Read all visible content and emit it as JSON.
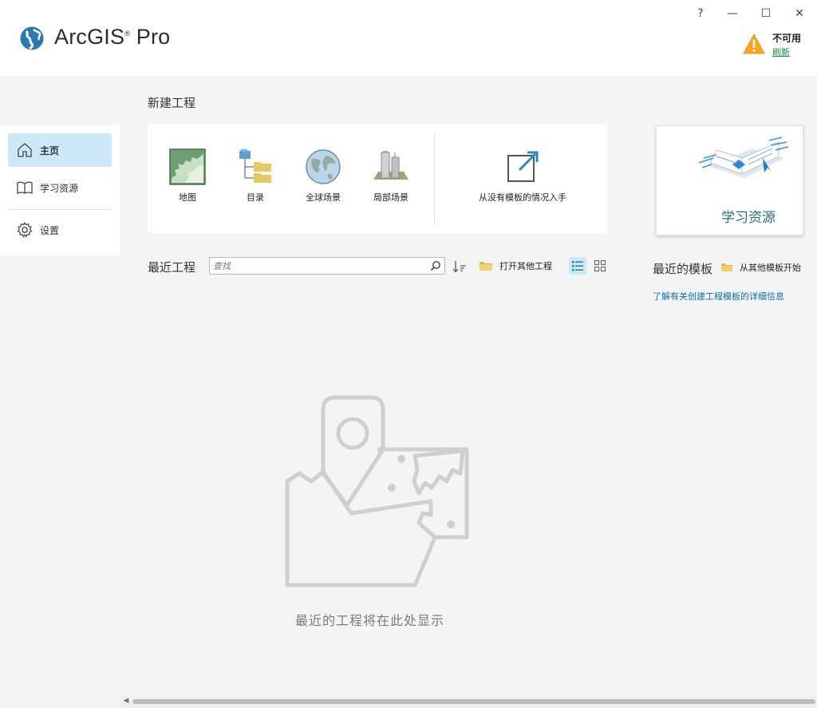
{
  "app": {
    "name": "ArcGIS",
    "name_suffix": "Pro"
  },
  "window": {
    "help": "?",
    "minimize": "—",
    "maximize": "☐",
    "close": "✕"
  },
  "license": {
    "status": "不可用",
    "refresh": "刷新"
  },
  "sidebar": {
    "items": [
      {
        "label": "主页",
        "icon": "home-icon",
        "selected": true
      },
      {
        "label": "学习资源",
        "icon": "book-icon"
      },
      {
        "label": "设置",
        "icon": "gear-icon"
      }
    ]
  },
  "new_project": {
    "title": "新建工程",
    "tiles": [
      {
        "label": "地图",
        "icon": "map-icon"
      },
      {
        "label": "目录",
        "icon": "catalog-icon"
      },
      {
        "label": "全球场景",
        "icon": "globe-icon"
      },
      {
        "label": "局部场景",
        "icon": "local-scene-icon"
      },
      {
        "label": "从没有模板的情况入手",
        "icon": "open-external-icon"
      }
    ]
  },
  "recent": {
    "title": "最近工程",
    "search_placeholder": "查找",
    "open_label": "打开其他工程",
    "empty_message": "最近的工程将在此处显示"
  },
  "learning_card": {
    "label": "学习资源"
  },
  "templates": {
    "title": "最近的模板",
    "open_label": "从其他模板开始",
    "learn_link": "了解有关创建工程模板的详细信息"
  },
  "colors": {
    "accent": "#cde8f7",
    "link": "#0a6fb7",
    "refresh": "#1a8a3a",
    "warning": "#f5a623",
    "logo": "#2a7ab0"
  }
}
